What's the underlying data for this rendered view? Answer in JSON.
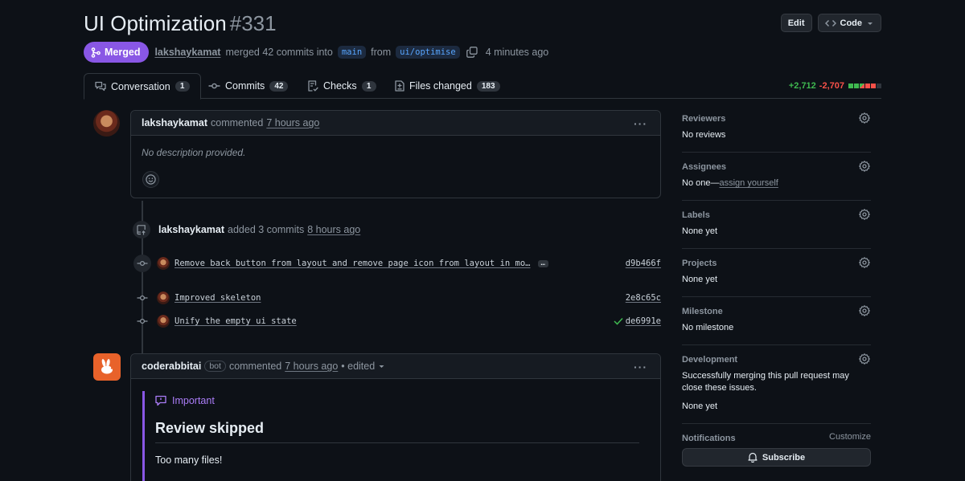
{
  "header": {
    "title": "UI Optimization",
    "number": "#331",
    "edit_label": "Edit",
    "code_label": "Code",
    "state_label": "Merged",
    "author": "lakshaykamat",
    "merge_text": "merged 42 commits into",
    "base_branch": "main",
    "from_text": "from",
    "head_branch": "ui/optimise",
    "time": "4 minutes ago"
  },
  "tabs": [
    {
      "label": "Conversation",
      "count": "1",
      "icon": "comment-discussion-icon"
    },
    {
      "label": "Commits",
      "count": "42",
      "icon": "git-commit-icon"
    },
    {
      "label": "Checks",
      "count": "1",
      "icon": "checklist-icon"
    },
    {
      "label": "Files changed",
      "count": "183",
      "icon": "file-diff-icon"
    }
  ],
  "diffstat": {
    "additions": "+2,712",
    "deletions": "-2,707"
  },
  "timeline": {
    "first_comment": {
      "author": "lakshaykamat",
      "action": "commented",
      "time": "7 hours ago",
      "body": "No description provided."
    },
    "commits_event": {
      "author": "lakshaykamat",
      "action": "added 3 commits",
      "time": "8 hours ago"
    },
    "commits": [
      {
        "message": "Remove back button from layout and remove page icon from layout in mo…",
        "sha": "d9b466f",
        "has_ellipsis": true
      },
      {
        "message": "Improved skeleton",
        "sha": "2e8c65c"
      },
      {
        "message": "Unify the empty ui state",
        "sha": "de6991e",
        "status": "success"
      }
    ],
    "bot_comment": {
      "author": "coderabbitai",
      "bot_label": "bot",
      "action": "commented",
      "time": "7 hours ago",
      "edited": "• edited",
      "callout_label": "Important",
      "heading": "Review skipped",
      "body": "Too many files!"
    }
  },
  "sidebar": {
    "reviewers": {
      "title": "Reviewers",
      "value": "No reviews"
    },
    "assignees": {
      "title": "Assignees",
      "value_prefix": "No one—",
      "value_link": "assign yourself"
    },
    "labels": {
      "title": "Labels",
      "value": "None yet"
    },
    "projects": {
      "title": "Projects",
      "value": "None yet"
    },
    "milestone": {
      "title": "Milestone",
      "value": "No milestone"
    },
    "development": {
      "title": "Development",
      "description": "Successfully merging this pull request may close these issues.",
      "value": "None yet"
    },
    "notifications": {
      "title": "Notifications",
      "customize": "Customize",
      "subscribe": "Subscribe"
    }
  },
  "colors": {
    "background": "#0d1117",
    "merged": "#8957e5",
    "additions": "#3fb950",
    "deletions": "#f85149",
    "link": "#58a6ff",
    "bot_avatar": "#e8622a"
  }
}
